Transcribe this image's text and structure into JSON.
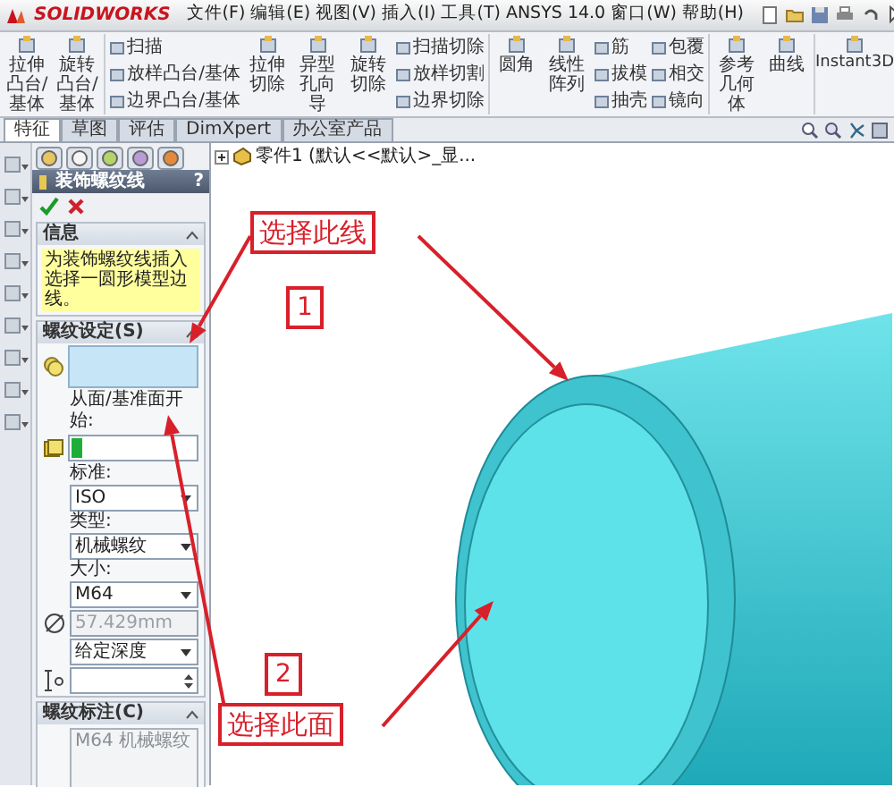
{
  "title_bar": {
    "logo": "SOLIDWORKS",
    "menu": [
      "文件(F)",
      "编辑(E)",
      "视图(V)",
      "插入(I)",
      "工具(T)",
      "ANSYS 14.0",
      "窗口(W)",
      "帮助(H)"
    ]
  },
  "toolbar": [
    {
      "kind": "big",
      "labels": [
        "拉伸凸台/基体"
      ]
    },
    {
      "kind": "big",
      "labels": [
        "旋转凸台/基体"
      ]
    },
    {
      "kind": "stack",
      "labels": [
        "扫描",
        "放样凸台/基体",
        "边界凸台/基体"
      ]
    },
    {
      "kind": "big",
      "labels": [
        "拉伸切除"
      ]
    },
    {
      "kind": "big",
      "labels": [
        "异型孔向导"
      ]
    },
    {
      "kind": "big",
      "labels": [
        "旋转切除"
      ]
    },
    {
      "kind": "stack",
      "labels": [
        "扫描切除",
        "放样切割",
        "边界切除"
      ]
    },
    {
      "kind": "big",
      "labels": [
        "圆角"
      ]
    },
    {
      "kind": "big",
      "labels": [
        "线性阵列"
      ]
    },
    {
      "kind": "stack",
      "labels": [
        "筋",
        "拔模",
        "抽壳"
      ]
    },
    {
      "kind": "stack",
      "labels": [
        "包覆",
        "相交",
        "镜向"
      ]
    },
    {
      "kind": "big",
      "labels": [
        "参考几何体"
      ]
    },
    {
      "kind": "big",
      "labels": [
        "曲线"
      ]
    },
    {
      "kind": "latin",
      "labels": [
        "Instant3D"
      ]
    }
  ],
  "command_tabs": [
    {
      "label": "特征",
      "selected": true
    },
    {
      "label": "草图",
      "selected": false
    },
    {
      "label": "评估",
      "selected": false
    },
    {
      "label": "DimXpert",
      "selected": false
    },
    {
      "label": "办公室产品",
      "selected": false
    }
  ],
  "property_manager": {
    "title": "装饰螺纹线",
    "help": "?",
    "info": {
      "heading": "信息",
      "text": "为装饰螺纹线插入选择一圆形模型边线。"
    },
    "thread_settings": {
      "heading": "螺纹设定(S)",
      "start_label": "从面/基准面开始:",
      "standard_label": "标准:",
      "standard": "ISO",
      "type_label": "类型:",
      "type": "机械螺纹",
      "size_label": "大小:",
      "size": "M64",
      "diameter": "57.429mm",
      "diameter_disabled": true,
      "end_condition": "给定深度"
    },
    "callout": {
      "heading": "螺纹标注(C)",
      "text": "M64 机械螺纹"
    }
  },
  "feature_tree": {
    "item": "零件1 (默认<<默认>_显..."
  },
  "annotations": [
    {
      "kind": "label",
      "text": "选择此线"
    },
    {
      "kind": "number",
      "text": "1"
    },
    {
      "kind": "number",
      "text": "2"
    },
    {
      "kind": "label",
      "text": "选择此面"
    }
  ]
}
